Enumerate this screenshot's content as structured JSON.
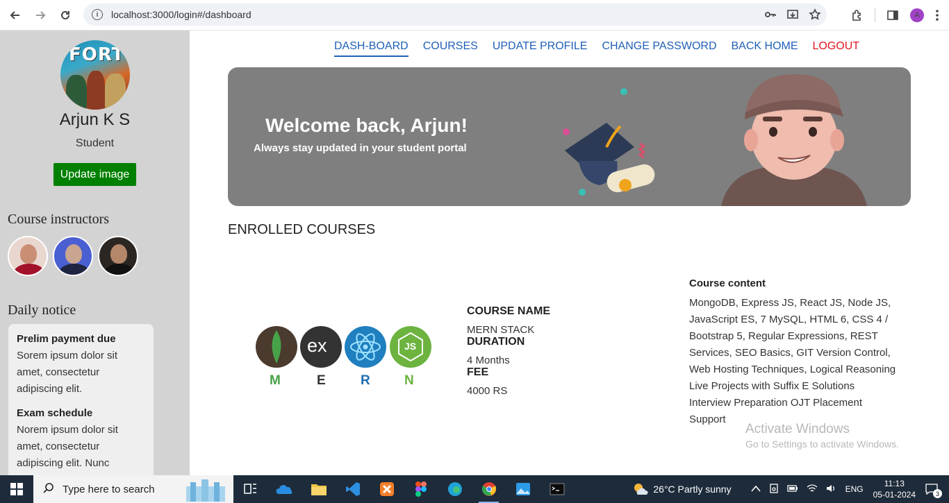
{
  "browser": {
    "url": "localhost:3000/login#/dashboard",
    "profile_initial": "A"
  },
  "sidebar": {
    "logo_text": "FORT",
    "student_name": "Arjun K S",
    "student_role": "Student",
    "update_button": "Update image",
    "instructors_title": "Course instructors",
    "notice_title": "Daily notice",
    "notices": [
      {
        "title": "Prelim payment due",
        "body": "Sorem ipsum dolor sit amet, consectetur adipiscing elit."
      },
      {
        "title": "Exam schedule",
        "body": "Norem ipsum dolor sit amet, consectetur adipiscing elit. Nunc"
      }
    ]
  },
  "nav": {
    "items": [
      "DASH-BOARD",
      "COURSES",
      "UPDATE PROFILE",
      "CHANGE PASSWORD",
      "BACK HOME",
      "LOGOUT"
    ]
  },
  "banner": {
    "title": "Welcome back, Arjun!",
    "subtitle": "Always stay updated in your student portal"
  },
  "enrolled": {
    "title": "ENROLLED COURSES",
    "logo_letters": [
      "M",
      "E",
      "R",
      "N"
    ],
    "logo_glyphs": [
      "ex",
      "JS"
    ],
    "course_name_label": "COURSE NAME",
    "course_name": "MERN STACK",
    "duration_label": "DURATION",
    "duration": "4 Months",
    "fee_label": "FEE",
    "fee": "4000 RS",
    "content_label": "Course content",
    "content": "MongoDB, Express JS, React JS, Node JS, JavaScript ES, 7 MySQL, HTML 6, CSS 4 / Bootstrap 5, Regular Expressions, REST Services, SEO Basics, GIT Version Control, Web Hosting Techniques, Logical Reasoning Live Projects with Suffix E Solutions Interview Preparation OJT Placement Support"
  },
  "watermark": {
    "line1": "Activate Windows",
    "line2": "Go to Settings to activate Windows."
  },
  "taskbar": {
    "search_placeholder": "Type here to search",
    "weather": "26°C  Partly sunny",
    "lang": "ENG",
    "time": "11:13",
    "date": "05-01-2024",
    "notif_count": "3"
  },
  "colors": {
    "sidebar_bg": "#d3d3d3",
    "banner_bg": "#7f7f7f",
    "update_button": "#008000",
    "nav_link": "#1f5fb5",
    "logout": "#e0141e"
  }
}
